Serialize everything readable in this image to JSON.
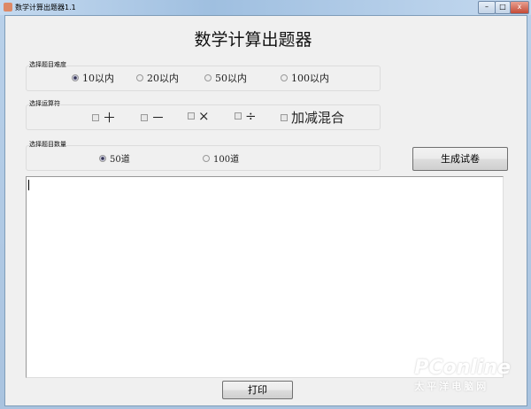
{
  "window": {
    "title": "数学计算出题器1.1",
    "minimize": "–",
    "maximize": "□",
    "close": "x"
  },
  "header": {
    "title": "数学计算出题器"
  },
  "difficulty": {
    "label": "选择题目难度",
    "options": [
      {
        "label": "10以内",
        "selected": true
      },
      {
        "label": "20以内",
        "selected": false
      },
      {
        "label": "50以内",
        "selected": false
      },
      {
        "label": "100以内",
        "selected": false
      }
    ]
  },
  "operators": {
    "label": "选择运算符",
    "options": [
      {
        "label": "＋",
        "checked": false
      },
      {
        "label": "－",
        "checked": false
      },
      {
        "label": "×",
        "checked": false
      },
      {
        "label": "÷",
        "checked": false
      },
      {
        "label": "加减混合",
        "checked": false
      }
    ]
  },
  "count": {
    "label": "选择题目数量",
    "options": [
      {
        "label": "50道",
        "selected": true
      },
      {
        "label": "100道",
        "selected": false
      }
    ]
  },
  "buttons": {
    "generate": "生成试卷",
    "print": "打印"
  },
  "output": {
    "value": ""
  },
  "watermark": {
    "text": "PConline",
    "sub": "太平洋电脑网"
  }
}
